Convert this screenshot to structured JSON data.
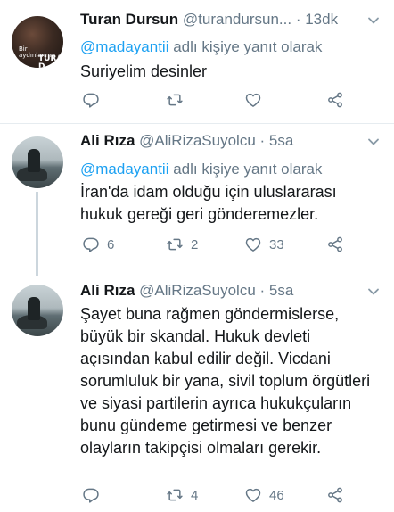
{
  "tweets": [
    {
      "name": "Turan Dursun",
      "handle": "@turandursun...",
      "dot": "·",
      "time": "13dk",
      "reply_prefix": "",
      "reply_handle": "@madayantii",
      "reply_suffix": " adlı kişiye yanıt olarak",
      "body": "Suriyelim desinler",
      "avatar_text_1": "Bir aydınlanma",
      "avatar_text_2": "TURAN D",
      "reply_count": "",
      "retweet_count": "",
      "like_count": ""
    },
    {
      "name": "Ali Rıza",
      "handle": "@AliRizaSuyolcu",
      "dot": "·",
      "time": "5sa",
      "reply_handle": "@madayantii",
      "reply_suffix": " adlı kişiye yanıt olarak",
      "body": "İran'da idam olduğu için uluslararası hukuk gereği geri gönderemezler.",
      "reply_count": "6",
      "retweet_count": "2",
      "like_count": "33"
    },
    {
      "name": "Ali Rıza",
      "handle": "@AliRizaSuyolcu",
      "dot": "·",
      "time": "5sa",
      "body": "Şayet buna rağmen göndermislerse, büyük bir skandal. Hukuk devleti açısından kabul edilir değil. Vicdani sorumluluk bir yana, sivil toplum örgütleri ve siyasi partilerin ayrıca hukukçuların bunu gündeme getirmesi ve benzer olayların takipçisi olmaları gerekir.",
      "reply_count": "",
      "retweet_count": "4",
      "like_count": "46"
    }
  ],
  "icons": {
    "reply": "reply-icon",
    "retweet": "retweet-icon",
    "like": "heart-icon",
    "share": "share-icon",
    "more": "chevron-down-icon"
  },
  "colors": {
    "link": "#1da1f2",
    "muted": "#657786",
    "text": "#14171a",
    "divider": "#e6ecf0"
  }
}
